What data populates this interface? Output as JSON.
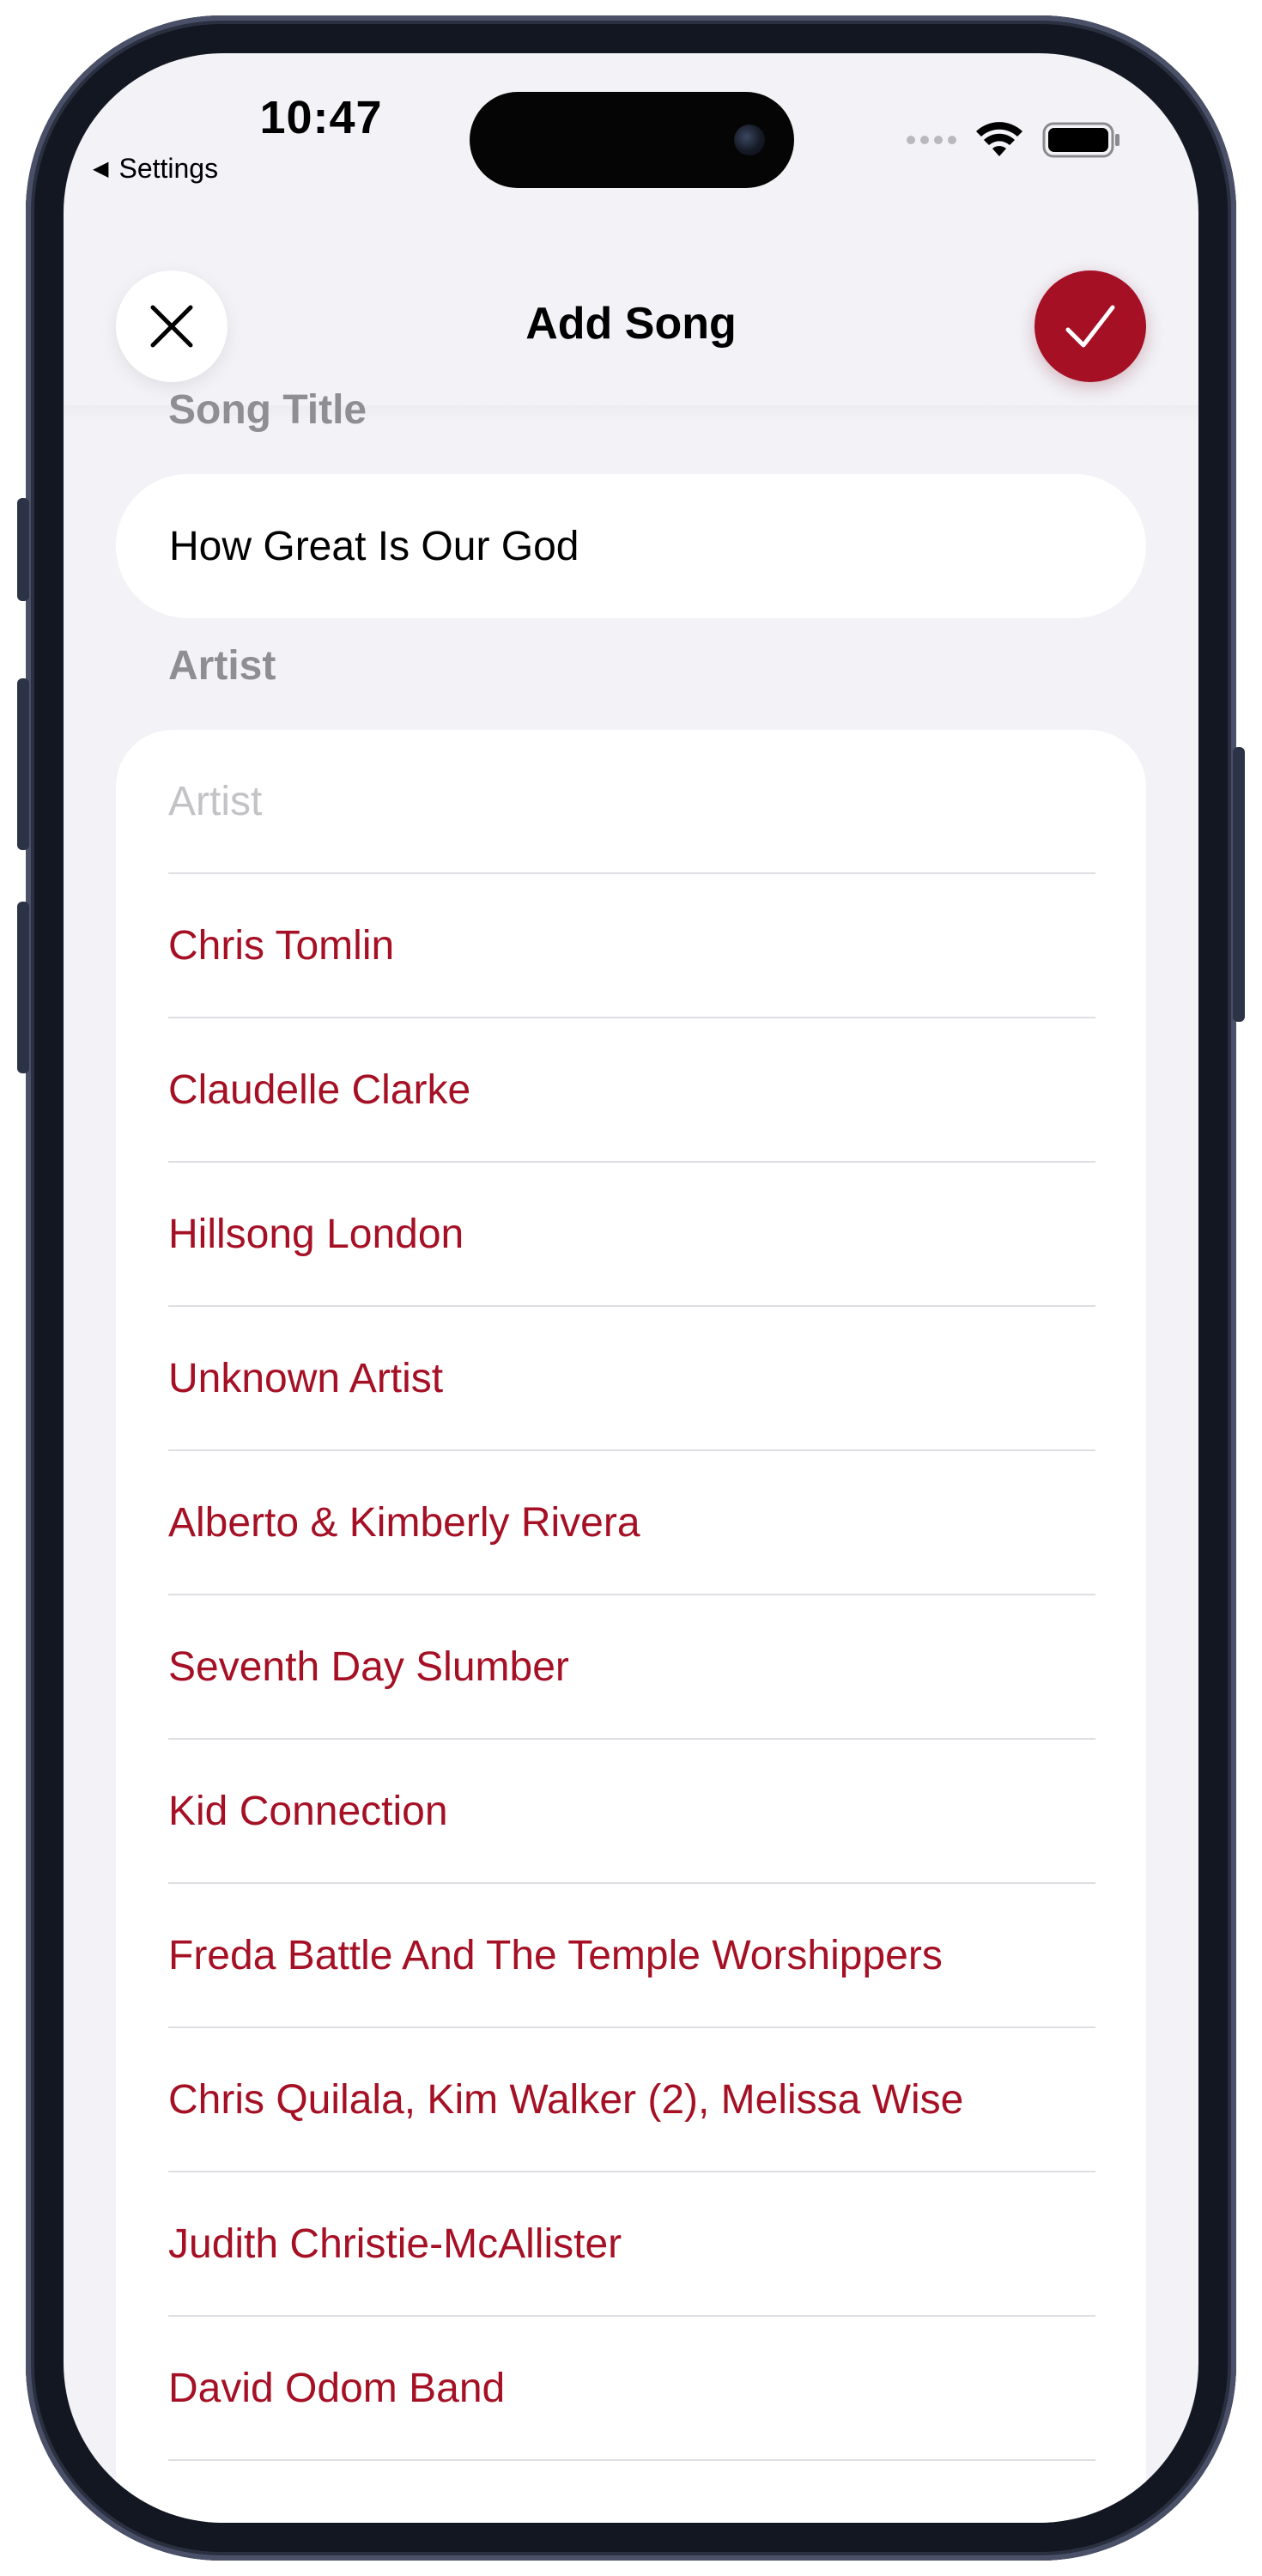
{
  "status_bar": {
    "time": "10:47",
    "back_label": "Settings",
    "back_icon": "triangle-left-icon",
    "signal_icon": "signal-dots-icon",
    "wifi_icon": "wifi-icon",
    "battery_icon": "battery-icon"
  },
  "nav": {
    "title": "Add Song",
    "close_icon": "close-icon",
    "done_icon": "checkmark-icon"
  },
  "form": {
    "song_title_label": "Song Title",
    "song_title_value": "How Great Is Our God",
    "artist_label": "Artist",
    "artist_placeholder": "Artist",
    "artist_suggestions": [
      "Chris Tomlin",
      "Claudelle Clarke",
      "Hillsong London",
      "Unknown Artist",
      "Alberto & Kimberly Rivera",
      "Seventh Day Slumber",
      "Kid Connection",
      "Freda Battle And The Temple Worshippers",
      "Chris Quilala, Kim Walker (2), Melissa Wise",
      "Judith Christie-McAllister",
      "David Odom Band"
    ]
  },
  "colors": {
    "accent": "#a51025",
    "background": "#f2f2f7",
    "secondary_label": "#8e8e93",
    "placeholder": "#c3c3c7"
  }
}
